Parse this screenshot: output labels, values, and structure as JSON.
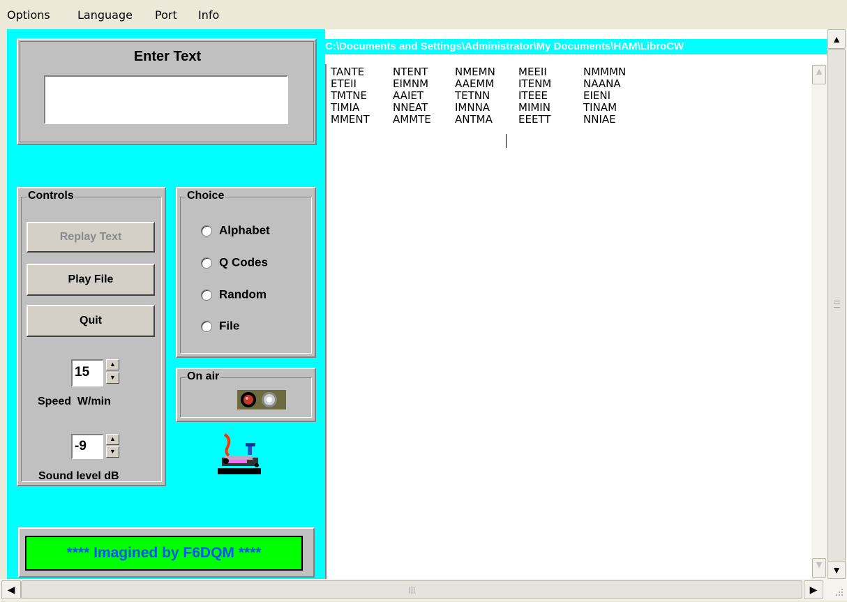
{
  "menu": {
    "items": [
      "Options",
      "Language",
      "Port",
      "Info"
    ]
  },
  "enter_text": {
    "title": "Enter Text",
    "value": ""
  },
  "controls": {
    "title": "Controls",
    "replay_label": "Replay Text",
    "play_label": "Play File",
    "quit_label": "Quit",
    "speed_value": "15",
    "speed_caption": "Speed  W/min",
    "sound_value": "-9",
    "sound_caption": "Sound level dB"
  },
  "choice": {
    "title": "Choice",
    "options": [
      "Alphabet",
      "Q Codes",
      "Random",
      "File"
    ]
  },
  "on_air": {
    "title": "On air"
  },
  "credit": "**** Imagined by F6DQM ****",
  "text_area": {
    "path": "C:\\Documents and Settings\\Administrator\\My Documents\\HAM\\LibroCW",
    "rows": [
      [
        "TANTE",
        "NTENT",
        "NMEMN",
        "MEEII",
        "NMMMN"
      ],
      [
        "ETEII",
        "EIMNM",
        "AAEMM",
        "ITENM",
        "NAANA"
      ],
      [
        "TMTNE",
        "AAIET",
        "TETNN",
        "ITEEE",
        "EIENI"
      ],
      [
        "TIMIA",
        "NNEAT",
        "IMNNA",
        "MIMIN",
        "TINAM"
      ],
      [
        "MMENT",
        "AMMTE",
        "ANTMA",
        "EEETT",
        "NNIAE"
      ]
    ]
  },
  "colors": {
    "form_bg": "#00ffff",
    "credit_bg": "#00ff00",
    "credit_text": "#0055ee"
  },
  "icons": {
    "scroll_up": "caret-up-icon",
    "scroll_down": "caret-down-icon",
    "scroll_left": "caret-left-icon",
    "scroll_right": "caret-right-icon",
    "on_air_indicator": "led-indicator-icon",
    "logo": "morse-key-icon"
  }
}
